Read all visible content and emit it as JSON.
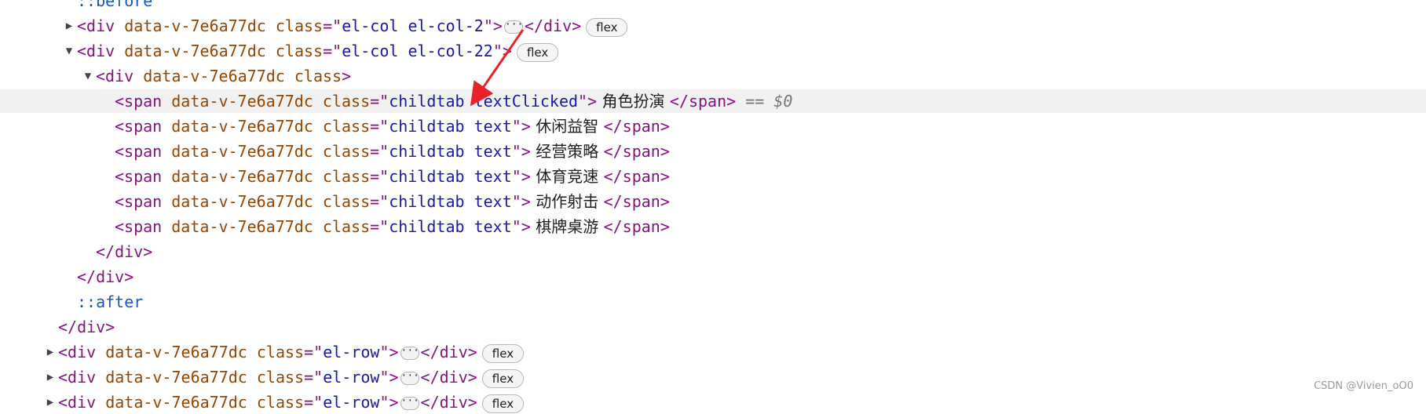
{
  "nodes": [
    {
      "indent": 0,
      "toggle": "none",
      "cut": true,
      "segs": [
        {
          "c": "c-pseudo",
          "t": "::before"
        }
      ]
    },
    {
      "indent": 0,
      "toggle": "collapsed",
      "segs": [
        {
          "c": "c-tag",
          "t": "<div "
        },
        {
          "c": "c-attr",
          "t": "data-v-7e6a77dc "
        },
        {
          "c": "c-attr",
          "t": "class"
        },
        {
          "c": "c-tag",
          "t": "=\""
        },
        {
          "c": "c-val",
          "t": "el-col el-col-2"
        },
        {
          "c": "c-tag",
          "t": "\">"
        },
        {
          "c": "ellipsis",
          "t": "···"
        },
        {
          "c": "c-tag",
          "t": "</div>"
        },
        {
          "c": "badge",
          "t": "flex"
        }
      ]
    },
    {
      "indent": 0,
      "toggle": "expanded",
      "segs": [
        {
          "c": "c-tag",
          "t": "<div "
        },
        {
          "c": "c-attr",
          "t": "data-v-7e6a77dc "
        },
        {
          "c": "c-attr",
          "t": "class"
        },
        {
          "c": "c-tag",
          "t": "=\""
        },
        {
          "c": "c-val",
          "t": "el-col el-col-22"
        },
        {
          "c": "c-tag",
          "t": "\">"
        },
        {
          "c": "badge",
          "t": "flex"
        }
      ]
    },
    {
      "indent": 1,
      "toggle": "expanded",
      "segs": [
        {
          "c": "c-tag",
          "t": "<div "
        },
        {
          "c": "c-attr",
          "t": "data-v-7e6a77dc "
        },
        {
          "c": "c-attr",
          "t": "class"
        },
        {
          "c": "c-tag",
          "t": ">"
        }
      ]
    },
    {
      "indent": 2,
      "toggle": "none",
      "selected": true,
      "segs": [
        {
          "c": "c-tag",
          "t": "<span "
        },
        {
          "c": "c-attr",
          "t": "data-v-7e6a77dc "
        },
        {
          "c": "c-attr",
          "t": "class"
        },
        {
          "c": "c-tag",
          "t": "=\""
        },
        {
          "c": "c-val",
          "t": "childtab textClicked"
        },
        {
          "c": "c-tag",
          "t": "\">"
        },
        {
          "c": "c-text",
          "t": " 角色扮演 "
        },
        {
          "c": "c-tag",
          "t": "</span>"
        },
        {
          "c": "c-eq",
          "t": " == "
        },
        {
          "c": "c-ref",
          "t": "$0"
        }
      ]
    },
    {
      "indent": 2,
      "toggle": "none",
      "segs": [
        {
          "c": "c-tag",
          "t": "<span "
        },
        {
          "c": "c-attr",
          "t": "data-v-7e6a77dc "
        },
        {
          "c": "c-attr",
          "t": "class"
        },
        {
          "c": "c-tag",
          "t": "=\""
        },
        {
          "c": "c-val",
          "t": "childtab text"
        },
        {
          "c": "c-tag",
          "t": "\">"
        },
        {
          "c": "c-text",
          "t": " 休闲益智 "
        },
        {
          "c": "c-tag",
          "t": "</span>"
        }
      ]
    },
    {
      "indent": 2,
      "toggle": "none",
      "segs": [
        {
          "c": "c-tag",
          "t": "<span "
        },
        {
          "c": "c-attr",
          "t": "data-v-7e6a77dc "
        },
        {
          "c": "c-attr",
          "t": "class"
        },
        {
          "c": "c-tag",
          "t": "=\""
        },
        {
          "c": "c-val",
          "t": "childtab text"
        },
        {
          "c": "c-tag",
          "t": "\">"
        },
        {
          "c": "c-text",
          "t": " 经营策略 "
        },
        {
          "c": "c-tag",
          "t": "</span>"
        }
      ]
    },
    {
      "indent": 2,
      "toggle": "none",
      "segs": [
        {
          "c": "c-tag",
          "t": "<span "
        },
        {
          "c": "c-attr",
          "t": "data-v-7e6a77dc "
        },
        {
          "c": "c-attr",
          "t": "class"
        },
        {
          "c": "c-tag",
          "t": "=\""
        },
        {
          "c": "c-val",
          "t": "childtab text"
        },
        {
          "c": "c-tag",
          "t": "\">"
        },
        {
          "c": "c-text",
          "t": " 体育竞速 "
        },
        {
          "c": "c-tag",
          "t": "</span>"
        }
      ]
    },
    {
      "indent": 2,
      "toggle": "none",
      "segs": [
        {
          "c": "c-tag",
          "t": "<span "
        },
        {
          "c": "c-attr",
          "t": "data-v-7e6a77dc "
        },
        {
          "c": "c-attr",
          "t": "class"
        },
        {
          "c": "c-tag",
          "t": "=\""
        },
        {
          "c": "c-val",
          "t": "childtab text"
        },
        {
          "c": "c-tag",
          "t": "\">"
        },
        {
          "c": "c-text",
          "t": " 动作射击 "
        },
        {
          "c": "c-tag",
          "t": "</span>"
        }
      ]
    },
    {
      "indent": 2,
      "toggle": "none",
      "segs": [
        {
          "c": "c-tag",
          "t": "<span "
        },
        {
          "c": "c-attr",
          "t": "data-v-7e6a77dc "
        },
        {
          "c": "c-attr",
          "t": "class"
        },
        {
          "c": "c-tag",
          "t": "=\""
        },
        {
          "c": "c-val",
          "t": "childtab text"
        },
        {
          "c": "c-tag",
          "t": "\">"
        },
        {
          "c": "c-text",
          "t": " 棋牌桌游 "
        },
        {
          "c": "c-tag",
          "t": "</span>"
        }
      ]
    },
    {
      "indent": 1,
      "toggle": "none",
      "segs": [
        {
          "c": "c-tag",
          "t": "</div>"
        }
      ]
    },
    {
      "indent": 0,
      "toggle": "none",
      "segs": [
        {
          "c": "c-tag",
          "t": "</div>"
        }
      ]
    },
    {
      "indent": 0,
      "toggle": "none",
      "segs": [
        {
          "c": "c-pseudo",
          "t": "::after"
        }
      ]
    },
    {
      "indent": -1,
      "toggle": "none",
      "segs": [
        {
          "c": "c-tag",
          "t": "</div>"
        }
      ]
    },
    {
      "indent": -1,
      "toggle": "collapsed",
      "segs": [
        {
          "c": "c-tag",
          "t": "<div "
        },
        {
          "c": "c-attr",
          "t": "data-v-7e6a77dc "
        },
        {
          "c": "c-attr",
          "t": "class"
        },
        {
          "c": "c-tag",
          "t": "=\""
        },
        {
          "c": "c-val",
          "t": "el-row"
        },
        {
          "c": "c-tag",
          "t": "\">"
        },
        {
          "c": "ellipsis",
          "t": "···"
        },
        {
          "c": "c-tag",
          "t": "</div>"
        },
        {
          "c": "badge",
          "t": "flex"
        }
      ]
    },
    {
      "indent": -1,
      "toggle": "collapsed",
      "segs": [
        {
          "c": "c-tag",
          "t": "<div "
        },
        {
          "c": "c-attr",
          "t": "data-v-7e6a77dc "
        },
        {
          "c": "c-attr",
          "t": "class"
        },
        {
          "c": "c-tag",
          "t": "=\""
        },
        {
          "c": "c-val",
          "t": "el-row"
        },
        {
          "c": "c-tag",
          "t": "\">"
        },
        {
          "c": "ellipsis",
          "t": "···"
        },
        {
          "c": "c-tag",
          "t": "</div>"
        },
        {
          "c": "badge",
          "t": "flex"
        }
      ]
    },
    {
      "indent": -1,
      "toggle": "collapsed",
      "cut": true,
      "segs": [
        {
          "c": "c-tag",
          "t": "<div "
        },
        {
          "c": "c-attr",
          "t": "data-v-7e6a77dc "
        },
        {
          "c": "c-attr",
          "t": "class"
        },
        {
          "c": "c-tag",
          "t": "=\""
        },
        {
          "c": "c-val",
          "t": "el-row"
        },
        {
          "c": "c-tag",
          "t": "\">"
        },
        {
          "c": "ellipsis",
          "t": "···"
        },
        {
          "c": "c-tag",
          "t": "</div>"
        },
        {
          "c": "badge",
          "t": "flex"
        }
      ]
    }
  ],
  "icons": {
    "collapsed": "▶",
    "expanded": "▼"
  },
  "annotation_color": "#e8222a",
  "watermark": "CSDN @Vivien_oO0"
}
